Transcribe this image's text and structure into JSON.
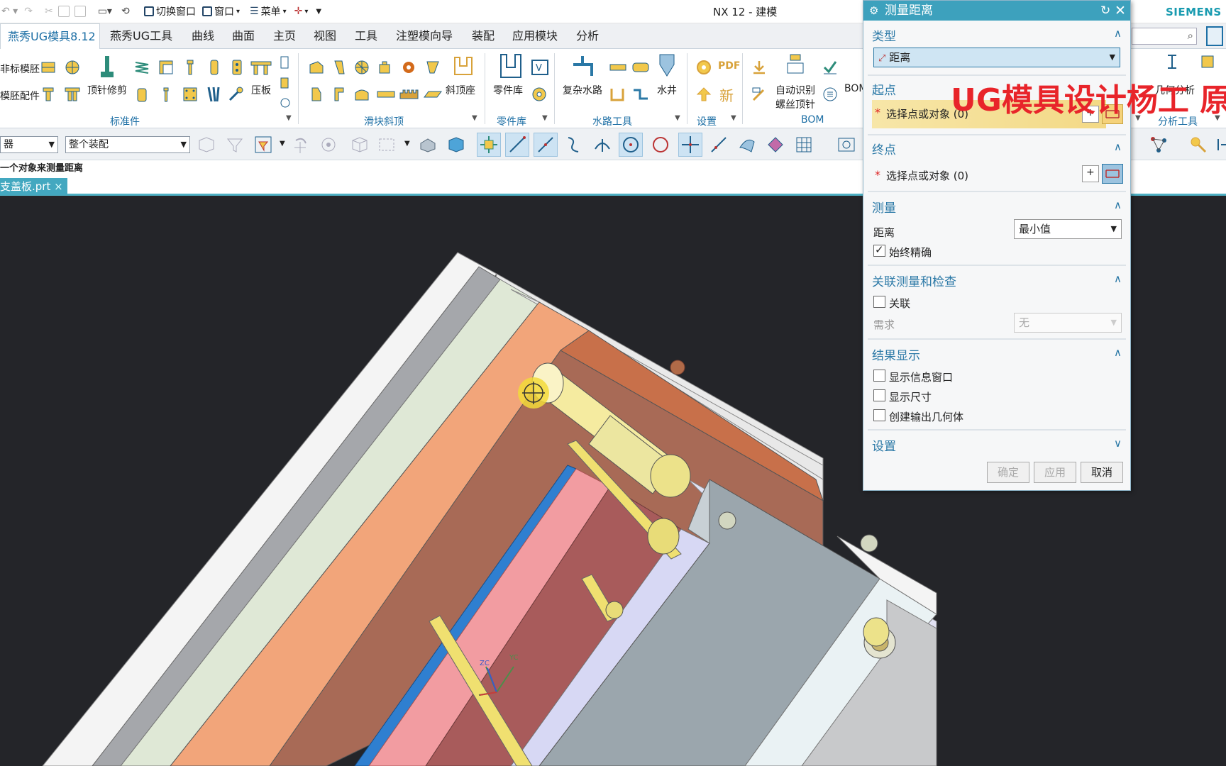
{
  "window": {
    "title": "NX 12 - 建模",
    "brand": "SIEMENS",
    "quick_access": {
      "switch_window": "切换窗口",
      "window": "窗口",
      "menu": "菜单"
    }
  },
  "ribbon_tabs": [
    "燕秀UG模具8.12",
    "燕秀UG工具",
    "曲线",
    "曲面",
    "主页",
    "视图",
    "工具",
    "注塑模向导",
    "装配",
    "应用模块",
    "分析"
  ],
  "ribbon": {
    "labels": {
      "std_mold": "非标模胚",
      "mold_parts": "模胚配件",
      "ejector_trim": "顶针修剪",
      "press_plate": "压板",
      "lifter_seat": "斜顶座",
      "part_lib": "零件库",
      "complex_water": "复杂水路",
      "water_well": "水井",
      "auto_identify": "自动识别",
      "screw_ejector": "螺丝顶针",
      "bom_btn": "BOM",
      "pdf": "PDF",
      "new": "新",
      "geom_analysis": "几何分析"
    },
    "groups": {
      "standard": "标准件",
      "slider": "滑块斜顶",
      "part_lib": "零件库",
      "water": "水路工具",
      "settings": "设置",
      "bom": "BOM",
      "analysis_tools": "分析工具"
    }
  },
  "toolbar": {
    "filter": "器",
    "scope": "整个装配"
  },
  "cue_line": "一个对象来测量距离",
  "file_tab": {
    "name": "支盖板.prt",
    "close": "×"
  },
  "dialog": {
    "title": "测量距离",
    "type": {
      "header": "类型",
      "value": "距离"
    },
    "start": {
      "header": "起点",
      "prompt": "选择点或对象 (0)"
    },
    "end": {
      "header": "终点",
      "prompt": "选择点或对象 (0)"
    },
    "measure": {
      "header": "测量",
      "distance_label": "距离",
      "distance_value": "最小值",
      "always_exact": "始终精确",
      "always_exact_checked": true
    },
    "assoc": {
      "header": "关联测量和检查",
      "associative": "关联",
      "associative_checked": false,
      "requirement_label": "需求",
      "requirement_value": "无"
    },
    "results": {
      "header": "结果显示",
      "show_info": "显示信息窗口",
      "show_dims": "显示尺寸",
      "create_geometry": "创建输出几何体"
    },
    "settings": {
      "header": "设置"
    },
    "buttons": {
      "ok": "确定",
      "apply": "应用",
      "cancel": "取消"
    },
    "required_mark": "*"
  },
  "viewport": {
    "triad": {
      "zc": "ZC",
      "yc": "YC"
    }
  },
  "overlay": {
    "watermark": "UG模具设计杨工 原"
  },
  "colors": {
    "accent": "#3da1bd",
    "section": "#2a78a6",
    "viewport_bg": "#242529",
    "watermark": "#e8242a"
  }
}
